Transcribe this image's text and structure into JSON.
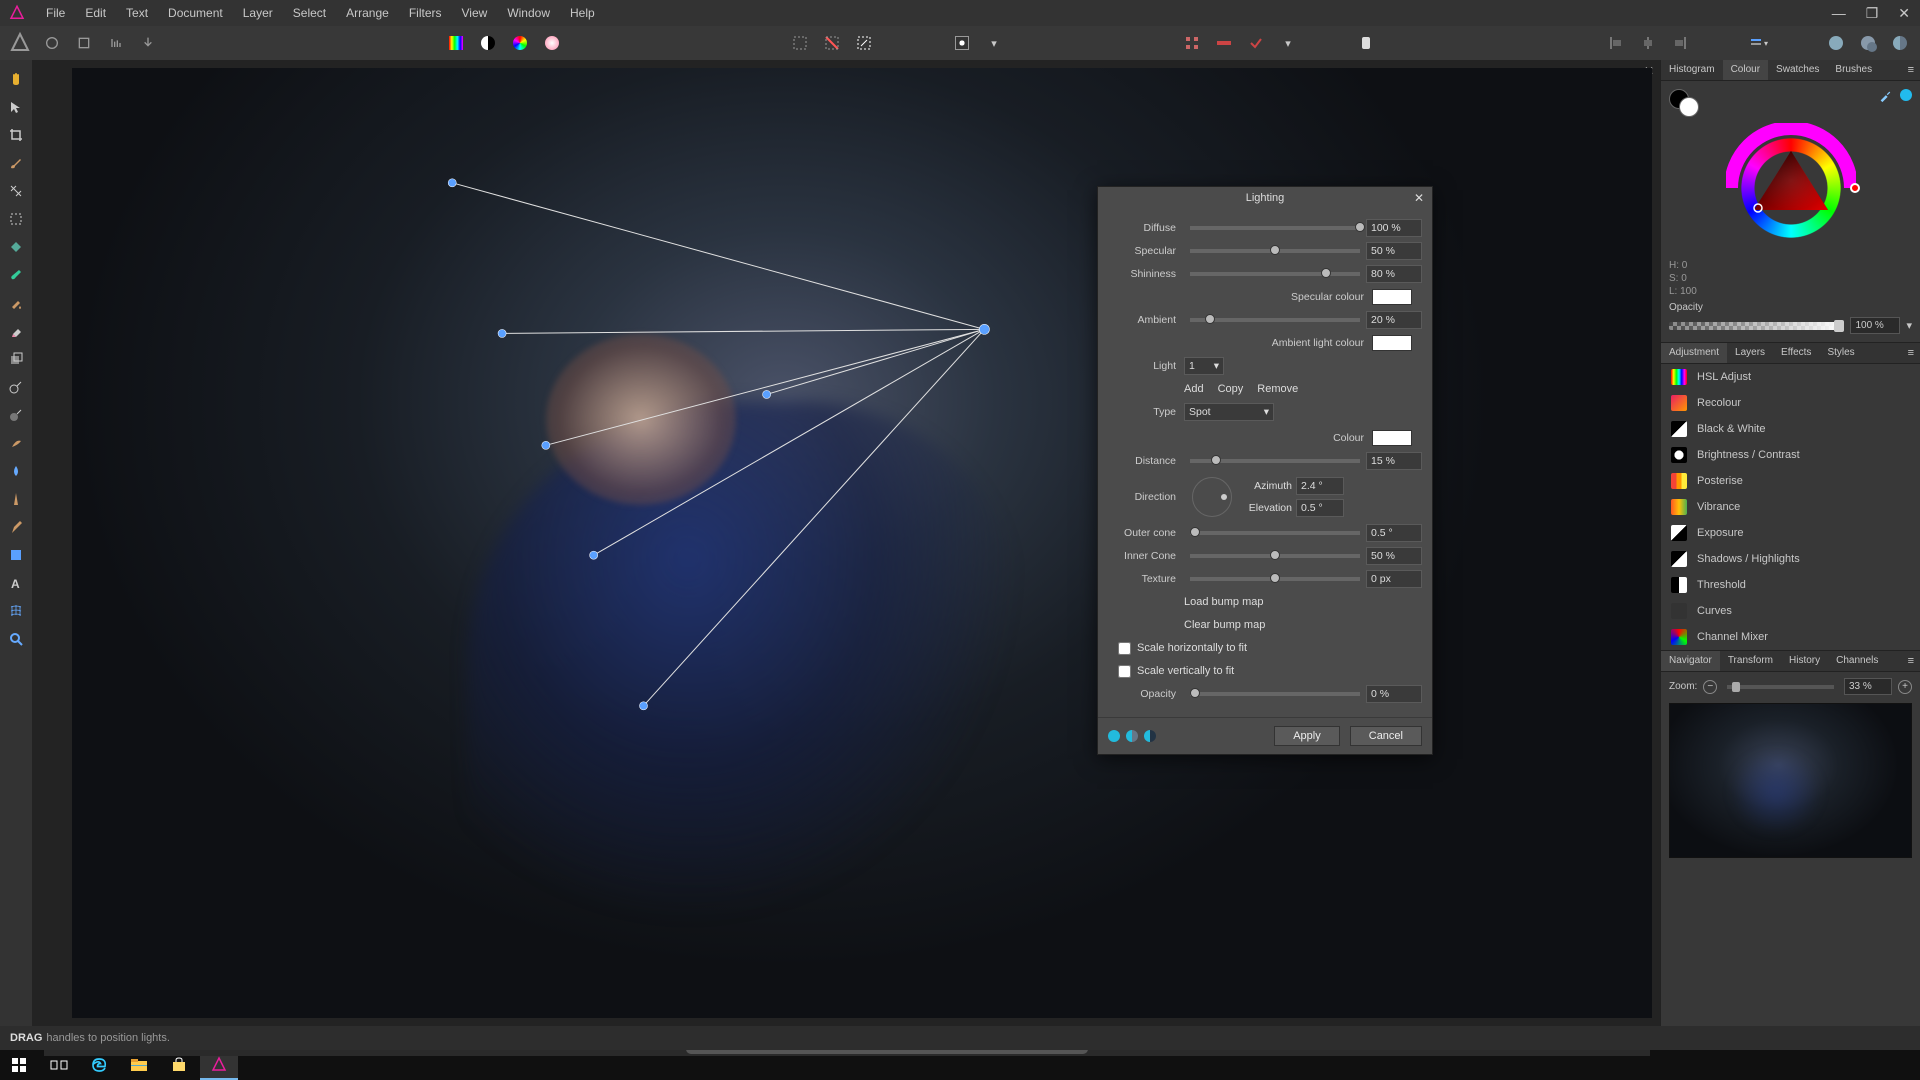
{
  "menu": [
    "File",
    "Edit",
    "Text",
    "Document",
    "Layer",
    "Select",
    "Arrange",
    "Filters",
    "View",
    "Window",
    "Help"
  ],
  "dialog": {
    "title": "Lighting",
    "diffuse": {
      "label": "Diffuse",
      "value": "100 %",
      "pos": 100
    },
    "specular": {
      "label": "Specular",
      "value": "50 %",
      "pos": 50
    },
    "shininess": {
      "label": "Shininess",
      "value": "80 %",
      "pos": 80
    },
    "specular_colour_label": "Specular colour",
    "ambient": {
      "label": "Ambient",
      "value": "20 %",
      "pos": 12
    },
    "ambient_colour_label": "Ambient light colour",
    "light_label": "Light",
    "light_value": "1",
    "actions": {
      "add": "Add",
      "copy": "Copy",
      "remove": "Remove"
    },
    "type_label": "Type",
    "type_value": "Spot",
    "colour_label": "Colour",
    "distance": {
      "label": "Distance",
      "value": "15 %",
      "pos": 15
    },
    "direction_label": "Direction",
    "azimuth": {
      "label": "Azimuth",
      "value": "2.4 °"
    },
    "elevation": {
      "label": "Elevation",
      "value": "0.5 °"
    },
    "outer_cone": {
      "label": "Outer cone",
      "value": "0.5 °",
      "pos": 3
    },
    "inner_cone": {
      "label": "Inner Cone",
      "value": "50 %",
      "pos": 50
    },
    "texture": {
      "label": "Texture",
      "value": "0 px",
      "pos": 50
    },
    "load_bump": "Load bump map",
    "clear_bump": "Clear bump map",
    "scale_h": "Scale horizontally to fit",
    "scale_v": "Scale vertically to fit",
    "opacity": {
      "label": "Opacity",
      "value": "0 %",
      "pos": 3
    },
    "apply": "Apply",
    "cancel": "Cancel"
  },
  "right": {
    "tabs_top": [
      "Histogram",
      "Colour",
      "Swatches",
      "Brushes"
    ],
    "hsl": {
      "h": "H: 0",
      "s": "S: 0",
      "l": "L: 100"
    },
    "opacity_label": "Opacity",
    "opacity_value": "100 %",
    "tabs_mid": [
      "Adjustment",
      "Layers",
      "Effects",
      "Styles"
    ],
    "adjustments": [
      {
        "label": "HSL Adjust",
        "bg": "linear-gradient(90deg,#f00,#ff0,#0f0,#0ff,#00f,#f0f,#f00)"
      },
      {
        "label": "Recolour",
        "bg": "linear-gradient(135deg,#e91e63,#ff9800)"
      },
      {
        "label": "Black & White",
        "bg": "linear-gradient(135deg,#000 49%,#fff 50%)"
      },
      {
        "label": "Brightness / Contrast",
        "bg": "radial-gradient(circle,#fff 40%,#000 41%)"
      },
      {
        "label": "Posterise",
        "bg": "linear-gradient(90deg,#f44336,#f44336 33%,#ff9800 33%,#ff9800 66%,#ffeb3b 66%)"
      },
      {
        "label": "Vibrance",
        "bg": "linear-gradient(90deg,#ff5722,#ffc107,#4caf50)"
      },
      {
        "label": "Exposure",
        "bg": "linear-gradient(135deg,#fff 49%,#000 50%)"
      },
      {
        "label": "Shadows / Highlights",
        "bg": "linear-gradient(135deg,#000 49%,#fff 50%)"
      },
      {
        "label": "Threshold",
        "bg": "linear-gradient(90deg,#000 49%,#fff 50%)"
      },
      {
        "label": "Curves",
        "bg": "#333"
      },
      {
        "label": "Channel Mixer",
        "bg": "conic-gradient(#f00,#0f0,#00f,#f00)"
      }
    ],
    "tabs_bot": [
      "Navigator",
      "Transform",
      "History",
      "Channels"
    ],
    "zoom_label": "Zoom:",
    "zoom_value": "33 %"
  },
  "statusbar": {
    "strong": "DRAG",
    "rest": "handles to position lights."
  }
}
